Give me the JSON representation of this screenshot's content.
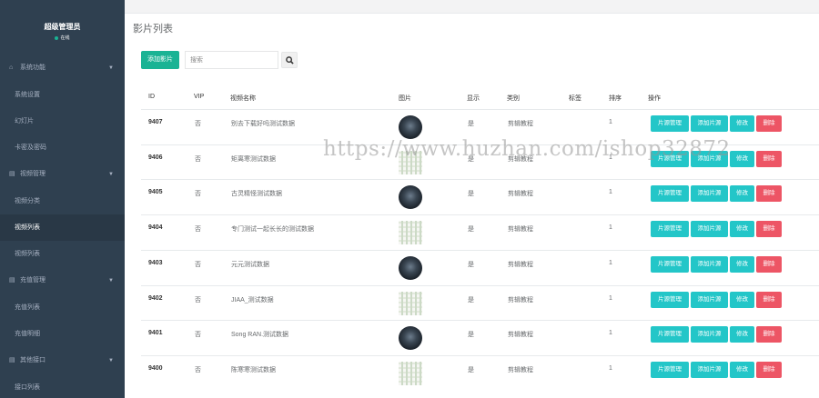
{
  "sidebar": {
    "profile": {
      "name": "超级管理员",
      "status": "在线"
    },
    "groups": [
      {
        "icon": "home-icon",
        "label": "系统功能",
        "items": [
          "系统设置",
          "幻灯片",
          "卡密及密码"
        ]
      },
      {
        "icon": "grid-icon",
        "label": "视频管理",
        "items": [
          "视频分类",
          "视频列表",
          "视频列表"
        ]
      },
      {
        "icon": "grid-icon",
        "label": "充值管理",
        "items": [
          "充值列表",
          "充值明细"
        ]
      },
      {
        "icon": "grid-icon",
        "label": "其他接口",
        "items": [
          "接口列表"
        ]
      }
    ]
  },
  "main": {
    "title": "影片列表",
    "add_button": "添加影片",
    "search_placeholder": "搜索",
    "columns": [
      "ID",
      "VIP",
      "视频名称",
      "图片",
      "显示",
      "类别",
      "标签",
      "排序",
      "操作"
    ],
    "rows": [
      {
        "id": "9407",
        "vip": "否",
        "name": "别去下载好吗测试数据",
        "thumb": "dark",
        "show": "是",
        "category": "剪辑教程",
        "tag": "",
        "sort": "1"
      },
      {
        "id": "9406",
        "vip": "否",
        "name": "矩离寒测试数据",
        "thumb": "light",
        "show": "是",
        "category": "剪辑教程",
        "tag": "",
        "sort": "1"
      },
      {
        "id": "9405",
        "vip": "否",
        "name": "古灵精怪测试数据",
        "thumb": "dark",
        "show": "是",
        "category": "剪辑教程",
        "tag": "",
        "sort": "1"
      },
      {
        "id": "9404",
        "vip": "否",
        "name": "专门测试一起长长的测试数据",
        "thumb": "light",
        "show": "是",
        "category": "剪辑教程",
        "tag": "",
        "sort": "1"
      },
      {
        "id": "9403",
        "vip": "否",
        "name": "元元测试数据",
        "thumb": "dark",
        "show": "是",
        "category": "剪辑教程",
        "tag": "",
        "sort": "1"
      },
      {
        "id": "9402",
        "vip": "否",
        "name": "JIAA_测试数据",
        "thumb": "light",
        "show": "是",
        "category": "剪辑教程",
        "tag": "",
        "sort": "1"
      },
      {
        "id": "9401",
        "vip": "否",
        "name": "Song RAN.测试数据",
        "thumb": "dark",
        "show": "是",
        "category": "剪辑教程",
        "tag": "",
        "sort": "1"
      },
      {
        "id": "9400",
        "vip": "否",
        "name": "陈寒寒测试数据",
        "thumb": "light",
        "show": "是",
        "category": "剪辑教程",
        "tag": "",
        "sort": "1"
      }
    ],
    "actions": {
      "src": "片源管理",
      "add_src": "添加片源",
      "edit": "修改",
      "delete": "删除"
    }
  },
  "watermark": "https://www.huzhan.com/ishop32872",
  "colors": {
    "sidebar_bg": "#2f4050",
    "primary": "#1ab394",
    "info": "#23c6c8",
    "danger": "#ed5565"
  }
}
